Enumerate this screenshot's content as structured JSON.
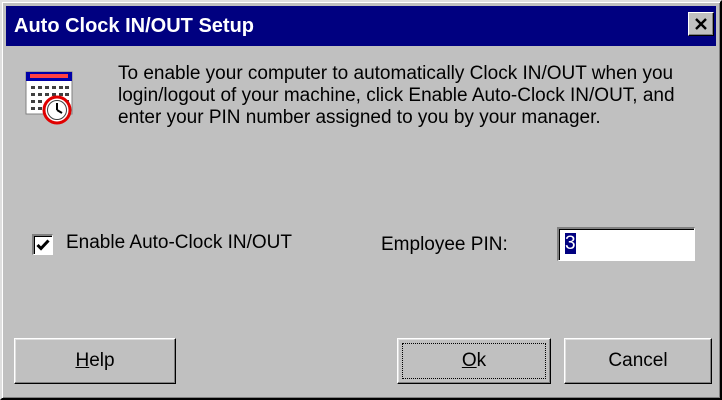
{
  "window": {
    "title": "Auto Clock IN/OUT Setup",
    "close_icon": "close-x-icon",
    "titlebar_color": "#000080",
    "face_color": "#c0c0c0"
  },
  "icon": {
    "name": "calendar-clock-icon"
  },
  "description": "To enable your computer to automatically Clock IN/OUT when you login/logout of your machine, click Enable Auto-Clock IN/OUT, and enter your PIN number assigned to you by your manager.",
  "auto_clock": {
    "label": "Enable Auto-Clock IN/OUT",
    "checked": true
  },
  "pin": {
    "label": "Employee PIN:",
    "value": "3"
  },
  "buttons": {
    "help": {
      "mnemonic": "H",
      "rest": "elp"
    },
    "ok": {
      "mnemonic": "O",
      "rest": "k"
    },
    "cancel": {
      "label": "Cancel"
    }
  }
}
